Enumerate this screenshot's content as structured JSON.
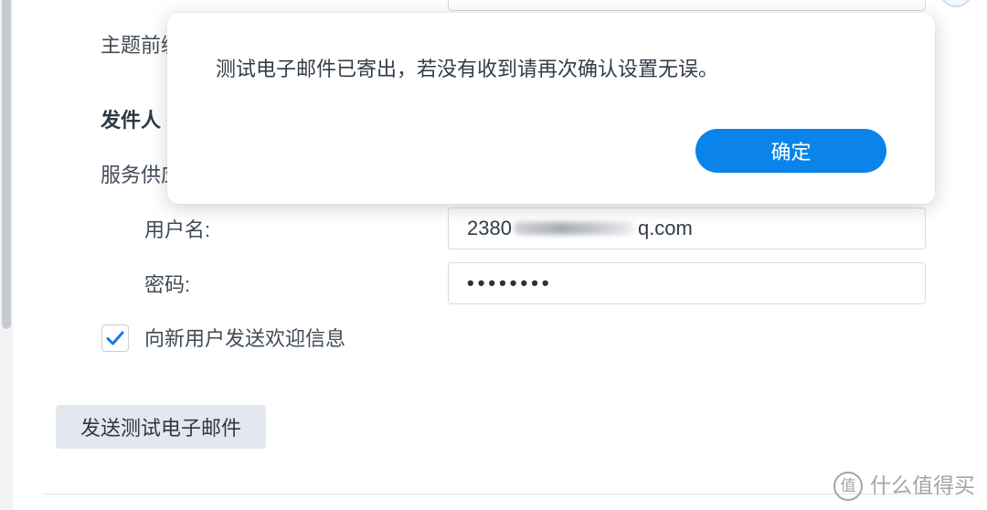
{
  "colors": {
    "accent": "#0a84ea",
    "checkbox_check": "#0a7fe5",
    "label_text": "#414b57",
    "secondary_button_bg": "#e3e8ef"
  },
  "form": {
    "subject_prefix_label": "主题前缀",
    "sender_section_heading": "发件人",
    "service_provider_label": "服务供应",
    "username": {
      "label": "用户名:",
      "value_start": "2380",
      "value_end": "q.com"
    },
    "password": {
      "label": "密码:",
      "value": "••••••••"
    },
    "welcome_message_checkbox": {
      "label": "向新用户发送欢迎信息",
      "checked": true
    },
    "send_test_email_button": "发送测试电子邮件"
  },
  "dialog": {
    "message": "测试电子邮件已寄出，若没有收到请再次确认设置无误。",
    "confirm_button": "确定"
  },
  "watermark": {
    "logo_glyph": "值",
    "text": "什么值得买"
  },
  "icons": {
    "checkbox": "check-icon",
    "help": "help-icon"
  }
}
